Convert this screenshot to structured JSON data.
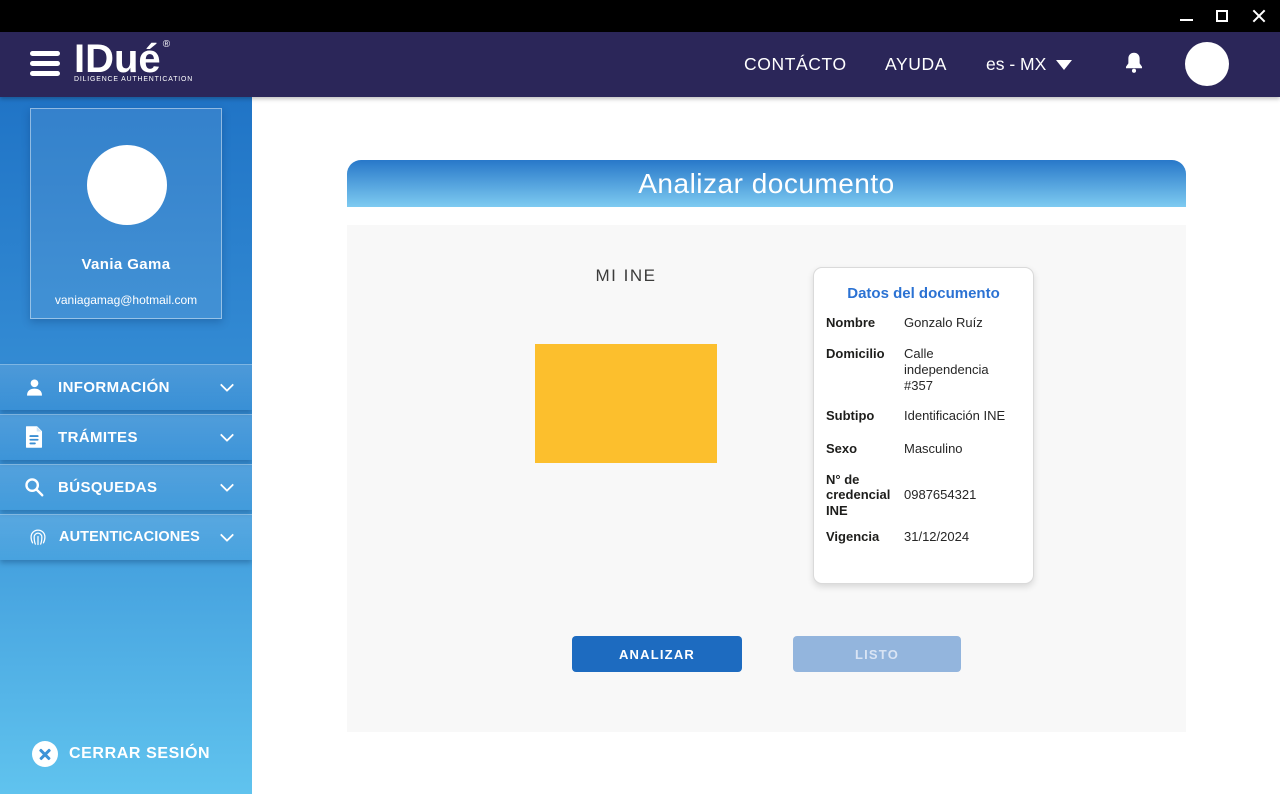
{
  "topbar": {
    "logo": {
      "title": "IDué",
      "registered": "®",
      "subtitle": "DILIGENCE AUTHENTICATION"
    },
    "nav": [
      {
        "label": "CONTÁCTO"
      },
      {
        "label": "AYUDA"
      }
    ],
    "language": {
      "value": "es - MX"
    }
  },
  "sidebar": {
    "profile": {
      "name": "Vania Gama",
      "email": "vaniagamag@hotmail.com"
    },
    "items": [
      {
        "label": "INFORMACIÓN",
        "icon": "user-icon"
      },
      {
        "label": "TRÁMITES",
        "icon": "document-icon"
      },
      {
        "label": "BÚSQUEDAS",
        "icon": "search-icon"
      },
      {
        "label": "AUTENTICACIONES",
        "icon": "fingerprint-icon"
      }
    ],
    "logout": {
      "label": "CERRAR SESIÓN",
      "icon": "close-circle-icon"
    }
  },
  "main": {
    "header": {
      "title": "Analizar documento"
    },
    "document_label": "MI INE",
    "card": {
      "title": "Datos del documento",
      "fields": [
        {
          "label": "Nombre",
          "value": "Gonzalo Ruíz"
        },
        {
          "label": "Domicilio",
          "value": "Calle independencia #357"
        },
        {
          "label": "Subtipo",
          "value": "Identificación INE"
        },
        {
          "label": "Sexo",
          "value": "Masculino"
        },
        {
          "label": "N° de credencial INE",
          "value": "0987654321"
        },
        {
          "label": "Vigencia",
          "value": "31/12/2024"
        }
      ]
    },
    "buttons": {
      "analyze": "ANALIZAR",
      "ready": "LISTO"
    }
  },
  "icons": {
    "window": [
      "minimize-icon",
      "maximize-icon",
      "close-icon"
    ],
    "menu": "hamburger-icon",
    "notifications": "bell-icon",
    "account": "user-avatar-icon",
    "language_caret": "triangle-down-icon",
    "sidebar_expand": "chevron-down-icon"
  },
  "colors": {
    "titlebar": "#000000",
    "appbar": "#2b2659",
    "sidebar_top": "#2074c6",
    "sidebar_bottom": "#60c3ee",
    "banner_top": "#2878c9",
    "banner_bottom": "#7ecbf1",
    "panel_bg": "#f8f8f8",
    "doc_placeholder": "#fcbf2d",
    "card_title": "#2b72d3",
    "analyze_button": "#1d6bc0",
    "ready_button": "#93b5dd"
  }
}
